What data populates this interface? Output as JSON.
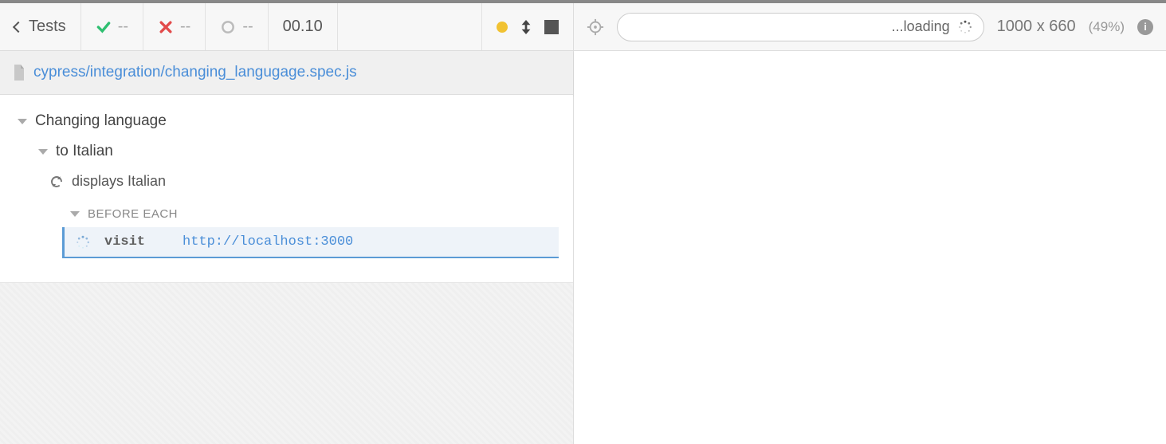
{
  "header": {
    "back_label": "Tests",
    "pass_count": "--",
    "fail_count": "--",
    "pending_count": "--",
    "timer": "00.10"
  },
  "file": {
    "path": "cypress/integration/changing_langugage.spec.js"
  },
  "tree": {
    "suite": "Changing language",
    "context": "to Italian",
    "test": "displays Italian",
    "hook_label": "BEFORE EACH",
    "command": {
      "name": "visit",
      "arg": "http://localhost:3000"
    }
  },
  "preview": {
    "url_value": "",
    "loading_label": "...loading",
    "viewport": "1000 x 660",
    "scale": "(49%)"
  }
}
